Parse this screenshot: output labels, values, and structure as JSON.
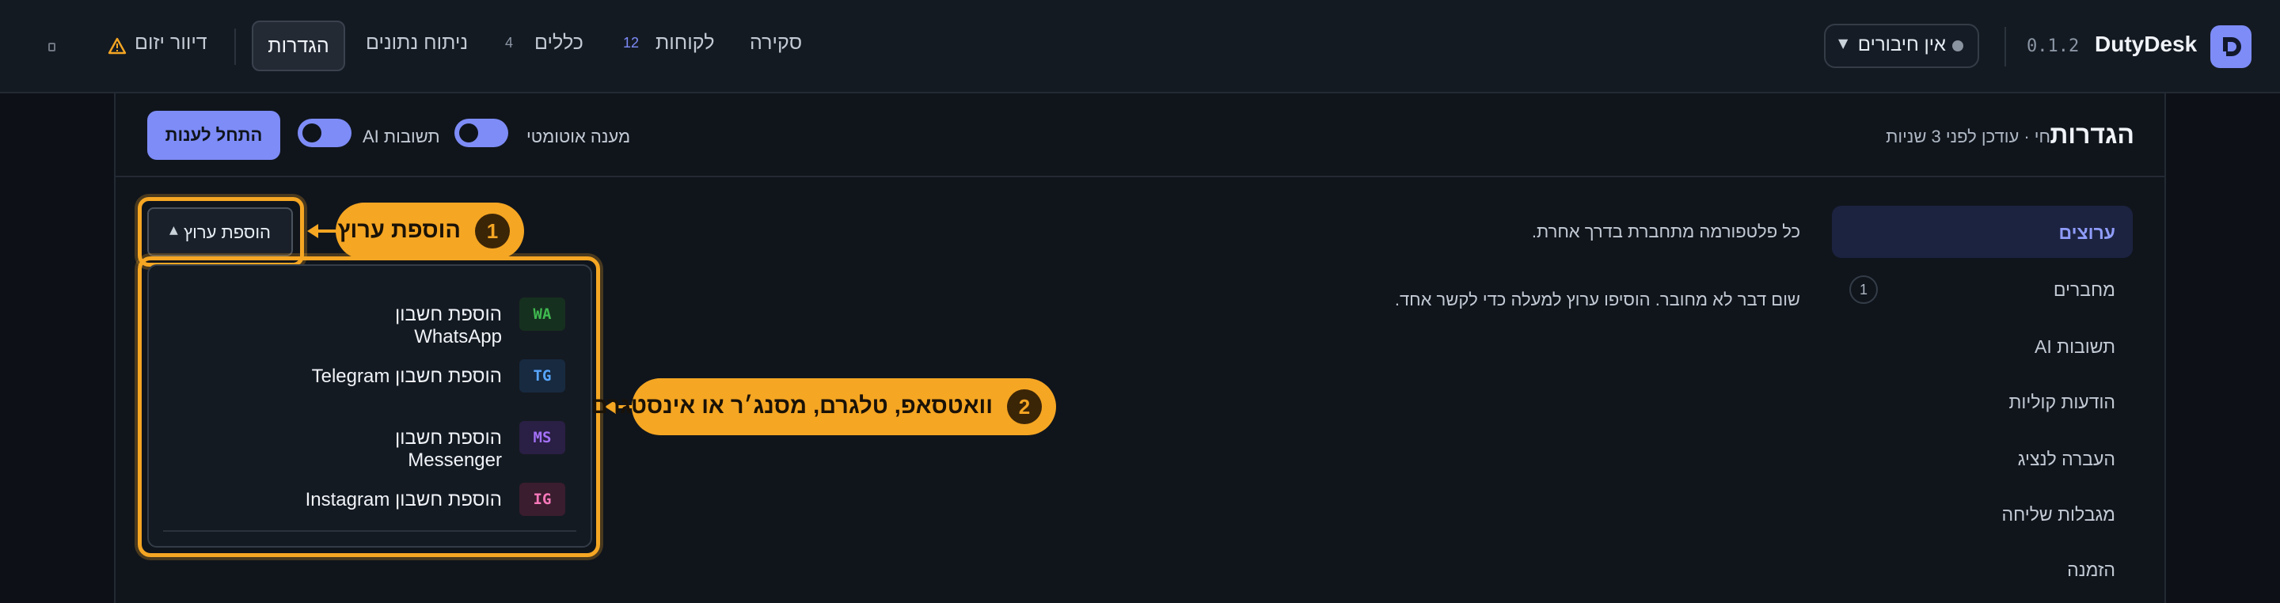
{
  "app": {
    "name": "DutyDesk",
    "version": "0.1.2",
    "connection_status": "אין חיבורים"
  },
  "nav": {
    "overview": "סקירה",
    "customers": "לקוחות",
    "customers_count": "12",
    "rules": "כללים",
    "rules_count": "4",
    "analytics": "ניתוח נתונים",
    "settings": "הגדרות",
    "proactive": "דיוור יזום"
  },
  "page": {
    "title": "הגדרות",
    "status": "חי · עודכן לפני 3 שניות",
    "auto_reply_label": "מענה אוטומטי",
    "ai_replies_label": "תשובות AI",
    "start_button": "התחל לענות"
  },
  "sidebar": {
    "items": [
      {
        "label": "ערוצים",
        "active": true
      },
      {
        "label": "מחברים",
        "badge": "1"
      },
      {
        "label": "תשובות AI"
      },
      {
        "label": "הודעות קוליות"
      },
      {
        "label": "העברה לנציג"
      },
      {
        "label": "מגבלות שליחה"
      },
      {
        "label": "הזמנה"
      }
    ]
  },
  "content": {
    "channels_desc": "כל פלטפורמה מתחברת בדרך אחרת.",
    "no_connection": "שום דבר לא מחובר. הוסיפו ערוץ למעלה כדי לקשר אחד."
  },
  "add_channel": {
    "button_label": "הוספת ערוץ",
    "menu": [
      {
        "code": "WA",
        "label": "הוספת חשבון WhatsApp",
        "fg": "#3fb950",
        "bg": "#16301f"
      },
      {
        "code": "TG",
        "label": "הוספת חשבון Telegram",
        "fg": "#58a6ff",
        "bg": "#172a40"
      },
      {
        "code": "MS",
        "label": "הוספת חשבון Messenger",
        "fg": "#a371f7",
        "bg": "#2a1f44"
      },
      {
        "code": "IG",
        "label": "הוספת חשבון Instagram",
        "fg": "#f778ba",
        "bg": "#3a1d2e"
      }
    ]
  },
  "callouts": {
    "c1": {
      "num": "1",
      "text": "הוספת ערוץ"
    },
    "c2": {
      "num": "2",
      "text": "וואטסאפ, טלגרם, מסנג׳ר או אינסטגרם"
    }
  },
  "colors": {
    "accent": "#7d8cf7",
    "highlight": "#f5a623",
    "background": "#0d1117"
  },
  "icons": {
    "brand": "brand-logo-icon",
    "warning": "warning-icon",
    "status_dot": "status-dot-icon",
    "caret": "caret-down-icon"
  }
}
